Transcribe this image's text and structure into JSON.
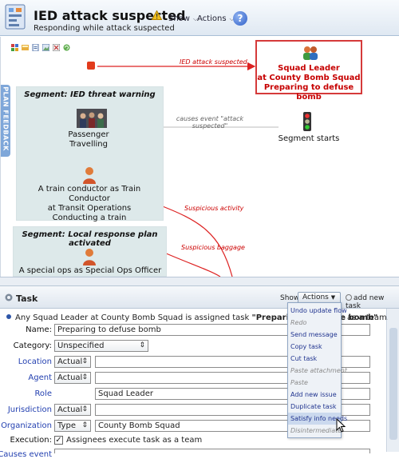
{
  "header": {
    "title": "IED attack suspected",
    "subtitle": "Responding while attack suspected",
    "show_label": "Show",
    "actions_label": "Actions",
    "help_label": "?"
  },
  "plan": {
    "feedback_tab": "PLAN FEEDBACK",
    "edge_ied": "IED attack suspected",
    "squad_leader": [
      "Squad Leader",
      "at County Bomb Squad",
      "Preparing to defuse bomb"
    ],
    "segment1_title": "Segment: IED threat warning",
    "passenger": [
      "Passenger",
      "Travelling"
    ],
    "causes_event": [
      "causes event \"attack",
      "suspected\""
    ],
    "segment_starts": "Segment starts",
    "conductor": [
      "A train conductor as Train Conductor",
      "at Transit Operations",
      "Conducting a train"
    ],
    "suspicious_activity": "Suspicious activity",
    "suspicious_baggage": "Suspicious baggage",
    "segment2_title": "Segment: Local response plan activated",
    "special_ops": "A special ops as Special Ops Officer"
  },
  "task": {
    "panel_title": "Task",
    "show_label": "Show",
    "actions_label": "Actions",
    "add_new_task": "add new task",
    "summary_prefix": "Any Squad Leader at County Bomb Squad is assigned task ",
    "summary_task": "\"Preparing to defuse bomb\"",
    "summary_suffix": "as a team.",
    "labels": {
      "name": "Name:",
      "category": "Category:",
      "location": "Location",
      "agent": "Agent",
      "role": "Role",
      "jurisdiction": "Jurisdiction",
      "organization": "Organization",
      "execution": "Execution:",
      "causes_event": "Causes event"
    },
    "values": {
      "name": "Preparing to defuse bomb",
      "category": "Unspecified",
      "location_kind": "Actual",
      "agent_kind": "Actual",
      "role": "Squad Leader",
      "jurisdiction_kind": "Actual",
      "organization_kind": "Type",
      "organization": "County Bomb Squad",
      "execution": "Assignees execute task as a team",
      "execution_checked": true
    }
  },
  "actions_menu": [
    {
      "label": "Undo update flow",
      "enabled": true
    },
    {
      "label": "Redo",
      "enabled": false
    },
    {
      "label": "Send message",
      "enabled": true
    },
    {
      "label": "Copy task",
      "enabled": true
    },
    {
      "label": "Cut task",
      "enabled": true
    },
    {
      "label": "Paste attachment",
      "enabled": false
    },
    {
      "label": "Paste",
      "enabled": false
    },
    {
      "label": "Add new issue",
      "enabled": true
    },
    {
      "label": "Duplicate task",
      "enabled": true
    },
    {
      "label": "Satisfy info needs",
      "enabled": true,
      "hover": true
    },
    {
      "label": "Disintermediate",
      "enabled": false
    }
  ],
  "colors": {
    "accent": "#2340b0",
    "alert_red": "#c60000",
    "segment_bg": "#dde9ea",
    "header_bg": "#dfe8f2"
  }
}
